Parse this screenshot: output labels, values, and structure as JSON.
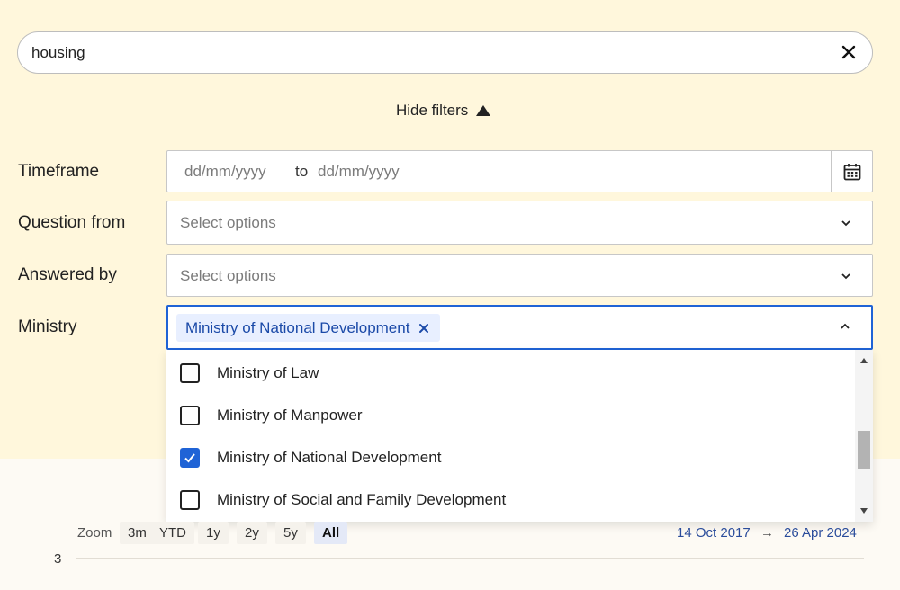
{
  "search": {
    "value": "housing"
  },
  "filters_toggle": {
    "label": "Hide filters"
  },
  "filters": {
    "timeframe": {
      "label": "Timeframe",
      "from_placeholder": "dd/mm/yyyy",
      "separator": "to",
      "to_placeholder": "dd/mm/yyyy"
    },
    "question_from": {
      "label": "Question from",
      "placeholder": "Select options"
    },
    "answered_by": {
      "label": "Answered by",
      "placeholder": "Select options"
    },
    "ministry": {
      "label": "Ministry",
      "selected_tag": "Ministry of National Development",
      "options": [
        {
          "label": "Ministry of Law",
          "checked": false
        },
        {
          "label": "Ministry of Manpower",
          "checked": false
        },
        {
          "label": "Ministry of National Development",
          "checked": true
        },
        {
          "label": "Ministry of Social and Family Development",
          "checked": false
        }
      ]
    }
  },
  "zoom": {
    "label": "Zoom",
    "buttons": [
      "3m",
      "YTD",
      "1y",
      "2y",
      "5y",
      "All"
    ],
    "active": "All"
  },
  "range": {
    "from": "14 Oct 2017",
    "arrow": "→",
    "to": "26 Apr 2024"
  },
  "chart": {
    "y_tick": "3"
  },
  "colors": {
    "accent": "#1f63d6",
    "tag_bg": "#e8efff",
    "top_bg": "#fff7dc"
  }
}
